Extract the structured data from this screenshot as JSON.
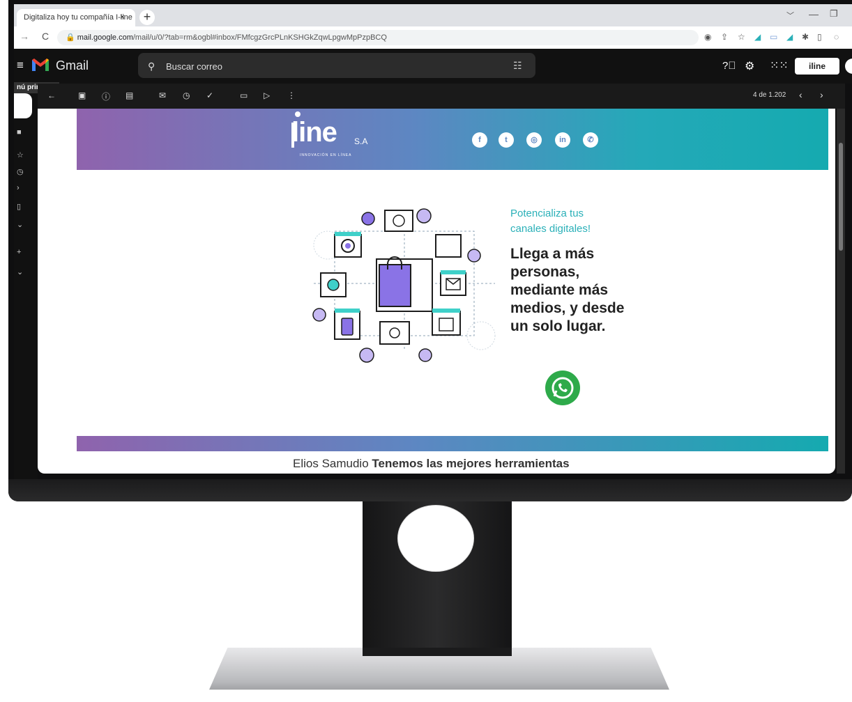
{
  "browser": {
    "tab_title": "Digitaliza hoy tu compañía I-line",
    "tab_close": "×",
    "new_tab": "+",
    "url_host": "mail.google.com",
    "url_path": "/mail/u/0/?tab=rm&ogbl#inbox/FMfcgzGrcPLnKSHGkZqwLpgwMpPzpBCQ"
  },
  "gmail": {
    "title": "Gmail",
    "search_placeholder": "Buscar correo",
    "tooltip": "nú principal",
    "page_count": "4 de 1.202",
    "account_label": "iline"
  },
  "email": {
    "brand_name": "line",
    "brand_suffix": "S.A",
    "brand_tagline": "INNOVACIÓN EN LÍNEA",
    "social_icons": [
      "facebook-icon",
      "twitter-icon",
      "instagram-icon",
      "linkedin-icon",
      "whatsapp-icon"
    ],
    "subhead": "Potencializa tus canales digitales!",
    "headline": "Llega a más personas, mediante más medios, y desde un solo lugar.",
    "signature_name": "Elios Samudio",
    "signature_text": "Tenemos las mejores herramientas"
  },
  "colors": {
    "banner_start": "#8f63ad",
    "banner_end": "#15aab0",
    "accent_teal": "#2ab0b8",
    "whatsapp_green": "#2eaa4a"
  }
}
